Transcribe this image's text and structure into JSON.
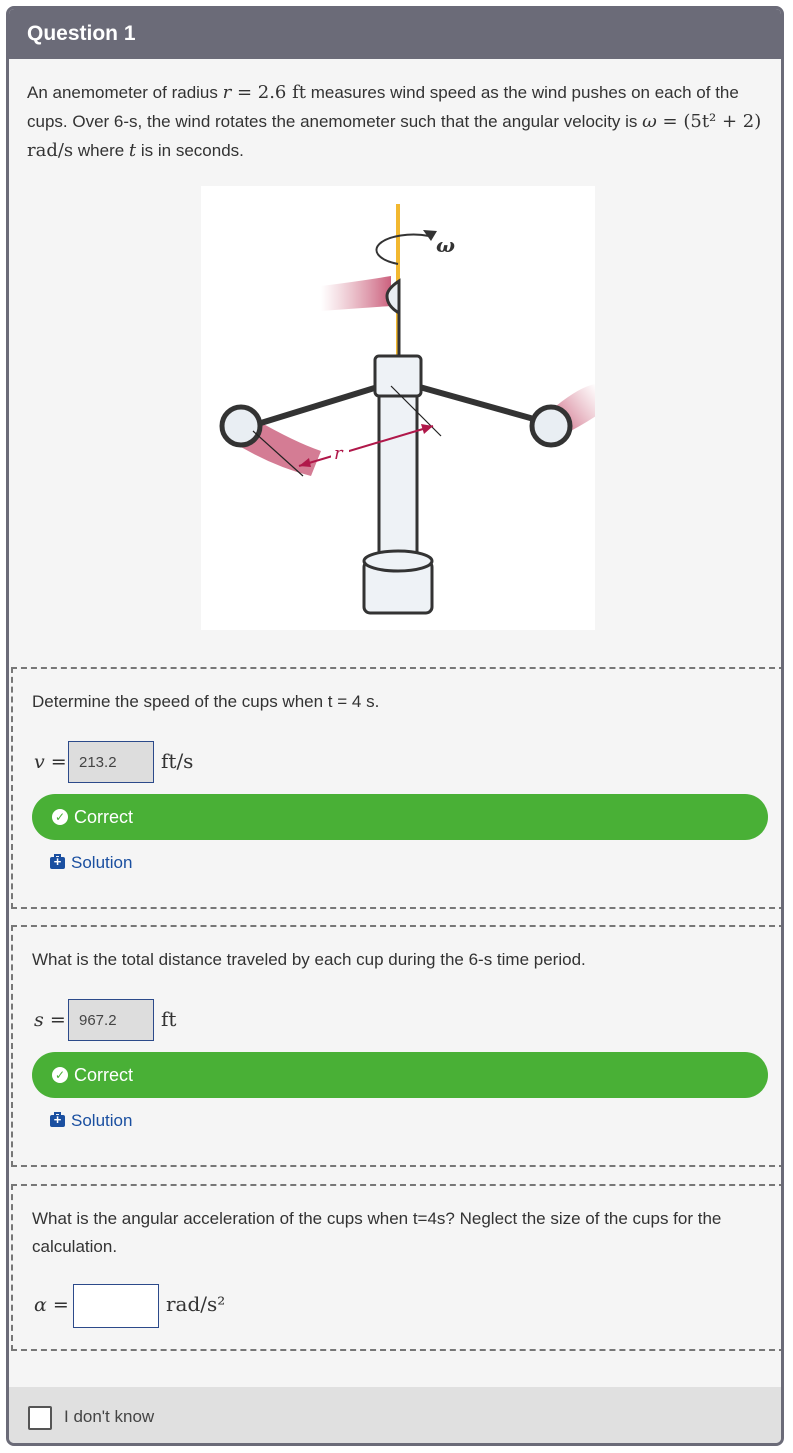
{
  "question": {
    "title": "Question 1",
    "intro": {
      "t1": "An anemometer of radius ",
      "r_var": "r",
      "r_eq": " = 2.6 ft",
      "t2": " measures wind speed as the wind pushes on each of the cups. Over 6-s, the wind rotates the anemometer such that the angular velocity is ",
      "w_var": "ω",
      "w_eq": " = (5t² + 2) rad/s",
      "t3": " where ",
      "t_var": "t",
      "t4": " is in seconds."
    },
    "figure": {
      "omega_label": "ω",
      "r_label": "r"
    }
  },
  "parts": [
    {
      "prompt": "Determine the speed of the cups when t = 4 s.",
      "lhs": "v",
      "eq": "=",
      "answer": "213.2",
      "unit": "ft/s",
      "status": "Correct",
      "solution_label": "Solution"
    },
    {
      "prompt": "What is the total distance traveled by each cup during the 6-s time period.",
      "lhs": "s",
      "eq": "=",
      "answer": "967.2",
      "unit": "ft",
      "status": "Correct",
      "solution_label": "Solution"
    },
    {
      "prompt": "What is the angular acceleration of the cups when t=4s? Neglect the size of the cups for the calculation.",
      "lhs": "α",
      "eq": "=",
      "answer": "",
      "unit": "rad/s²"
    }
  ],
  "footer": {
    "dont_know_label": "I don't know"
  },
  "colors": {
    "header": "#6b6b78",
    "correct": "#49b036",
    "link": "#1a4fa0",
    "accent_red": "#b0184a"
  }
}
